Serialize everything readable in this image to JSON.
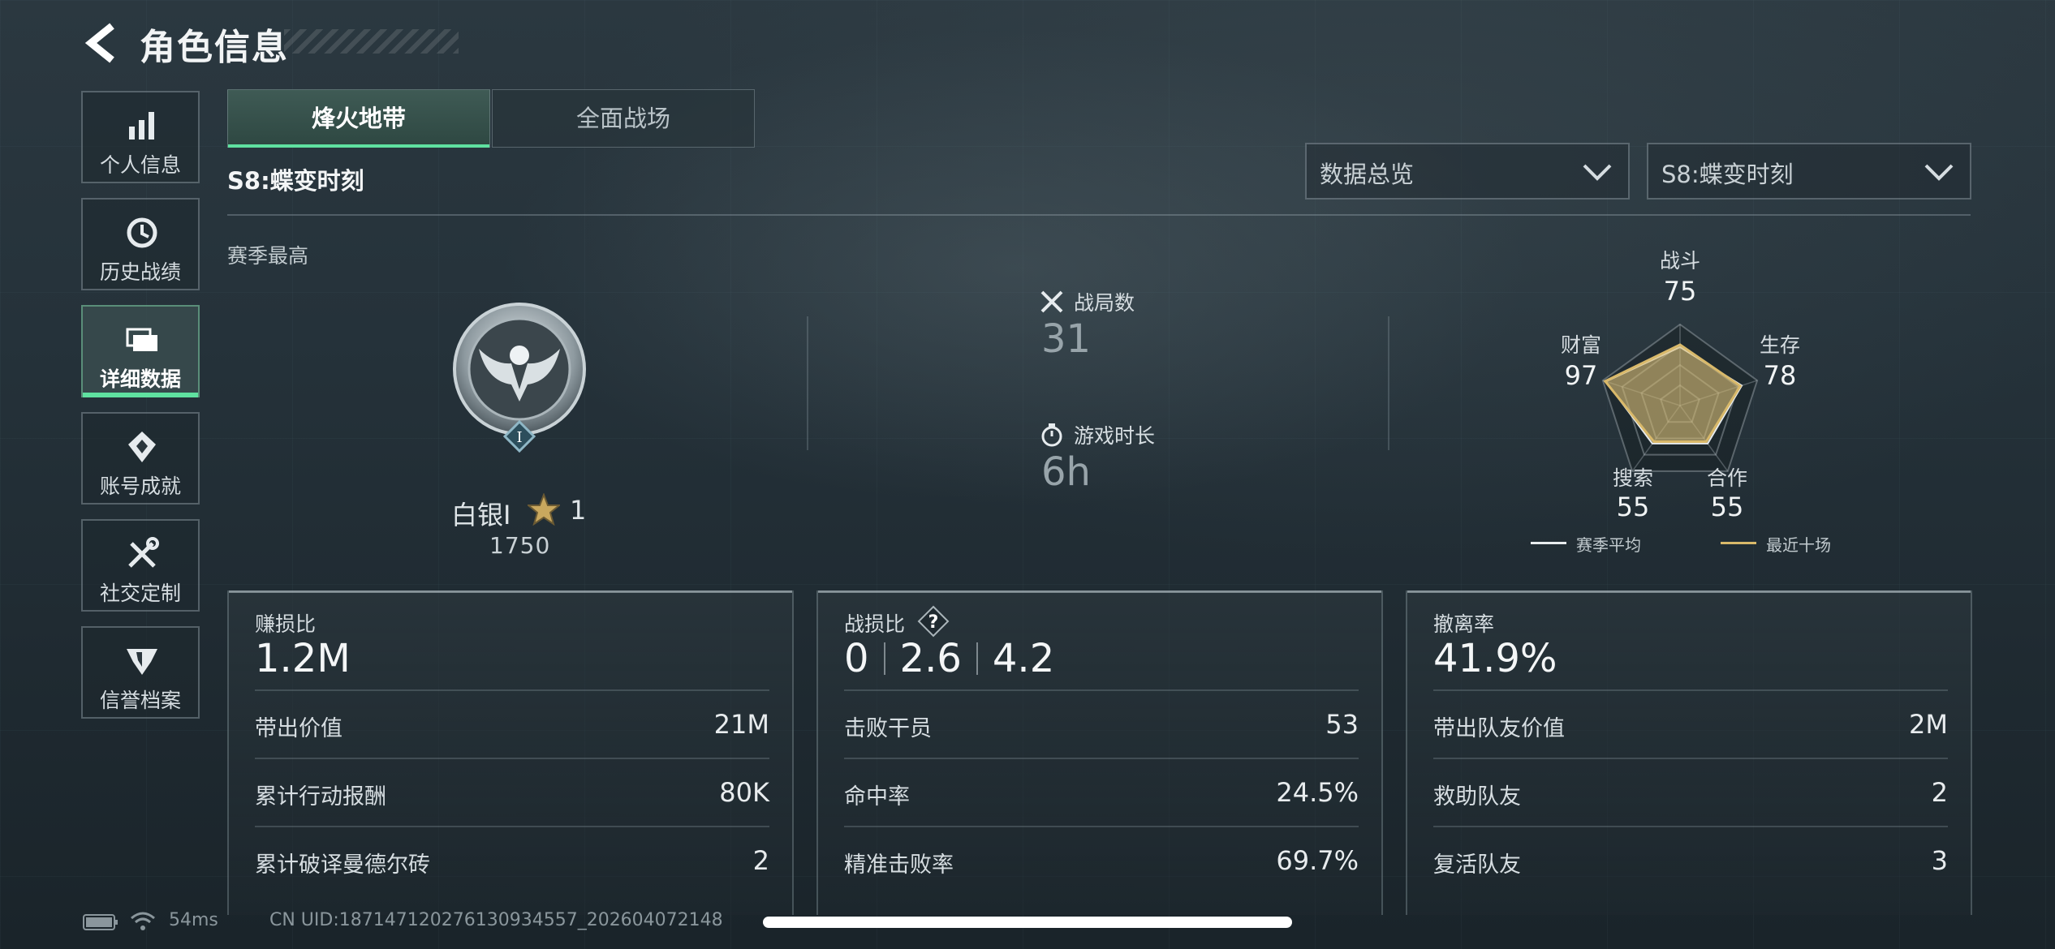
{
  "header": {
    "title": "角色信息",
    "back_icon": "chevron-left-icon"
  },
  "sidebar": {
    "items": [
      {
        "label": "个人信息",
        "icon": "bar-chart-icon",
        "active": false
      },
      {
        "label": "历史战绩",
        "icon": "history-clock-icon",
        "active": false
      },
      {
        "label": "详细数据",
        "icon": "folder-stack-icon",
        "active": true
      },
      {
        "label": "账号成就",
        "icon": "medal-icon",
        "active": false
      },
      {
        "label": "社交定制",
        "icon": "tools-icon",
        "active": false
      },
      {
        "label": "信誉档案",
        "icon": "shield-wing-icon",
        "active": false
      }
    ]
  },
  "tabs": [
    {
      "label": "烽火地带",
      "active": true
    },
    {
      "label": "全面战场",
      "active": false
    }
  ],
  "season_title": "S8:蝶变时刻",
  "dropdowns": {
    "view": {
      "value": "数据总览"
    },
    "season": {
      "value": "S8:蝶变时刻"
    }
  },
  "section_label": "赛季最高",
  "rank": {
    "name": "白银I",
    "stars": "1",
    "score": "1750"
  },
  "stats": {
    "matches": {
      "label": "战局数",
      "value": "31",
      "icon": "crossed-swords-icon"
    },
    "playtime": {
      "label": "游戏时长",
      "value": "6h",
      "icon": "stopwatch-icon"
    }
  },
  "radar": {
    "labels": {
      "combat": {
        "label": "战斗",
        "value": "75"
      },
      "survival": {
        "label": "生存",
        "value": "78"
      },
      "teamwork": {
        "label": "合作",
        "value": "55"
      },
      "search": {
        "label": "搜索",
        "value": "55"
      },
      "wealth": {
        "label": "财富",
        "value": "97"
      }
    },
    "legend": {
      "season_avg": "赛季平均",
      "last_ten": "最近十场"
    },
    "colors": {
      "season_avg": "#e8ecee",
      "last_ten": "#d9b96a"
    },
    "season_avg_values": [
      72,
      80,
      58,
      58,
      96
    ],
    "last_ten_values": [
      75,
      78,
      55,
      55,
      97
    ]
  },
  "cards": {
    "profit": {
      "title": "赚损比",
      "big": "1.2M",
      "rows": [
        {
          "label": "带出价值",
          "value": "21M"
        },
        {
          "label": "累计行动报酬",
          "value": "80K"
        },
        {
          "label": "累计破译曼德尔砖",
          "value": "2"
        }
      ]
    },
    "kd": {
      "title": "战损比",
      "values": [
        "0",
        "2.6",
        "4.2"
      ],
      "help_icon": "question-icon",
      "rows": [
        {
          "label": "击败干员",
          "value": "53"
        },
        {
          "label": "命中率",
          "value": "24.5%"
        },
        {
          "label": "精准击败率",
          "value": "69.7%"
        }
      ]
    },
    "extract": {
      "title": "撤离率",
      "big": "41.9%",
      "rows": [
        {
          "label": "带出队友价值",
          "value": "2M"
        },
        {
          "label": "救助队友",
          "value": "2"
        },
        {
          "label": "复活队友",
          "value": "3"
        }
      ]
    }
  },
  "status_bar": {
    "ping": "54ms",
    "uid": "CN UID:18714712027613093​4557_202604072148"
  }
}
